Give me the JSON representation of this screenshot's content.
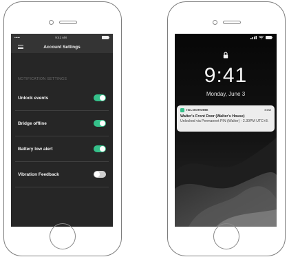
{
  "left_phone": {
    "status_bar": {
      "signal": "•••••",
      "time": "9:41 AM"
    },
    "app_bar": {
      "title": "Account Settings"
    },
    "section_label": "NOTIFICATION SETTINGS",
    "settings": [
      {
        "label": "Unlock events",
        "enabled": true
      },
      {
        "label": "Bridge offline",
        "enabled": true
      },
      {
        "label": "Battery low alert",
        "enabled": true
      },
      {
        "label": "Vibration Feedback",
        "enabled": false
      }
    ],
    "colors": {
      "toggle_on": "#35c08a",
      "toggle_off": "#cfcfcf",
      "screen_bg": "#262626"
    }
  },
  "right_phone": {
    "time": "9:41",
    "date": "Monday, June 3",
    "notification": {
      "app_name": "IGLOOHOME",
      "time": "now",
      "title": "Walter's Front Door (Walter's House)",
      "body": "Unlocked via Permanent PIN (Walter) - 2.30PM UTC+8."
    }
  }
}
